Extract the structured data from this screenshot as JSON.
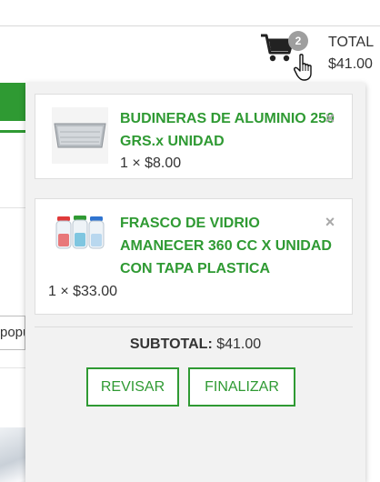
{
  "header": {
    "cart_count": "2",
    "total_label": "TOTAL",
    "total_amount": "$41.00"
  },
  "background": {
    "sort_select_value": "popularidad"
  },
  "cart": {
    "items": [
      {
        "name": "BUDINERAS DE ALUMINIO 250 GRS.x UNIDAD",
        "quantity_price": "1 × $8.00",
        "thumb_icon": "aluminum-tray-image"
      },
      {
        "name": "FRASCO DE VIDRIO AMANECER 360 CC X UNIDAD CON TAPA PLASTICA",
        "quantity_price": "1 × $33.00",
        "thumb_icon": "glass-jars-image"
      }
    ],
    "remove_glyph": "×",
    "subtotal_label": "SUBTOTAL:",
    "subtotal_value": "$41.00",
    "review_label": "REVISAR",
    "checkout_label": "FINALIZAR"
  },
  "colors": {
    "accent": "#2f9a33",
    "badge": "#9e9e9e",
    "dropdown_bg": "#f2f2f2"
  }
}
